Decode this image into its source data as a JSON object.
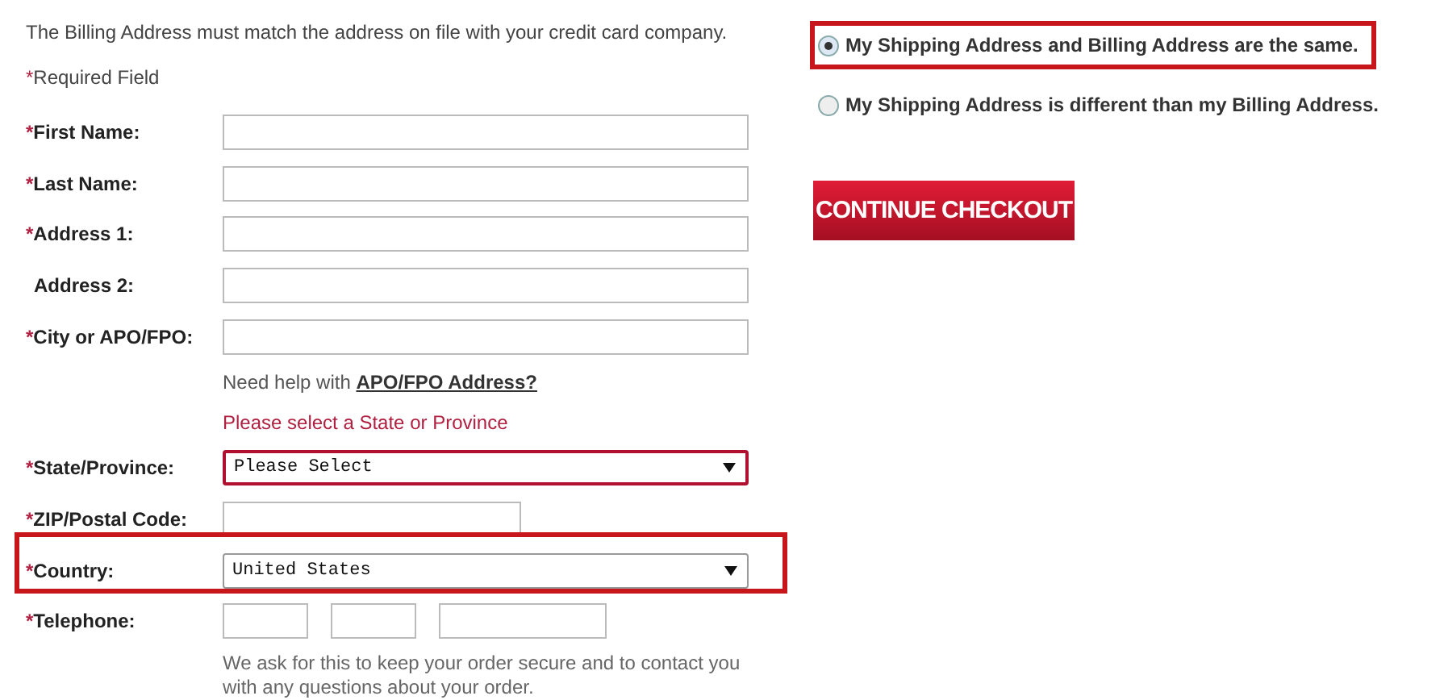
{
  "billing_notice": "The Billing Address must match the address on file with your credit card company.",
  "required_note": {
    "mark": "*",
    "text": "Required Field"
  },
  "fields": [
    {
      "kind": "text",
      "mark": "*",
      "label": "First Name:"
    },
    {
      "kind": "text",
      "mark": "*",
      "label": "Last Name:"
    },
    {
      "kind": "text",
      "mark": "*",
      "label": "Address 1:"
    },
    {
      "kind": "text",
      "label": "Address 2:"
    },
    {
      "kind": "text",
      "mark": "*",
      "label": "City or APO/FPO:",
      "help": {
        "text": "Need help with",
        "link": "APO/FPO Address?"
      },
      "error": "Please select a State or Province"
    },
    {
      "kind": "select",
      "mark": "*",
      "label": "State/Province:",
      "value": "Please Select",
      "invalid": true,
      "highlighted": false
    },
    {
      "kind": "zip",
      "mark": "*",
      "label": "ZIP/Postal Code:"
    },
    {
      "kind": "select",
      "mark": "*",
      "label": "Country:",
      "value": "United States",
      "invalid": false,
      "highlighted": true
    },
    {
      "kind": "phone",
      "mark": "*",
      "label": "Telephone:",
      "note": "We ask for this to keep your order secure and to contact you with any questions about your order."
    }
  ],
  "address_options": [
    {
      "label": "My Shipping Address and Billing Address are the same.",
      "selected": true,
      "highlighted": true
    },
    {
      "label": "My Shipping Address is different than my Billing Address.",
      "selected": false,
      "highlighted": false
    }
  ],
  "continue_button": "CONTINUE CHECKOUT"
}
